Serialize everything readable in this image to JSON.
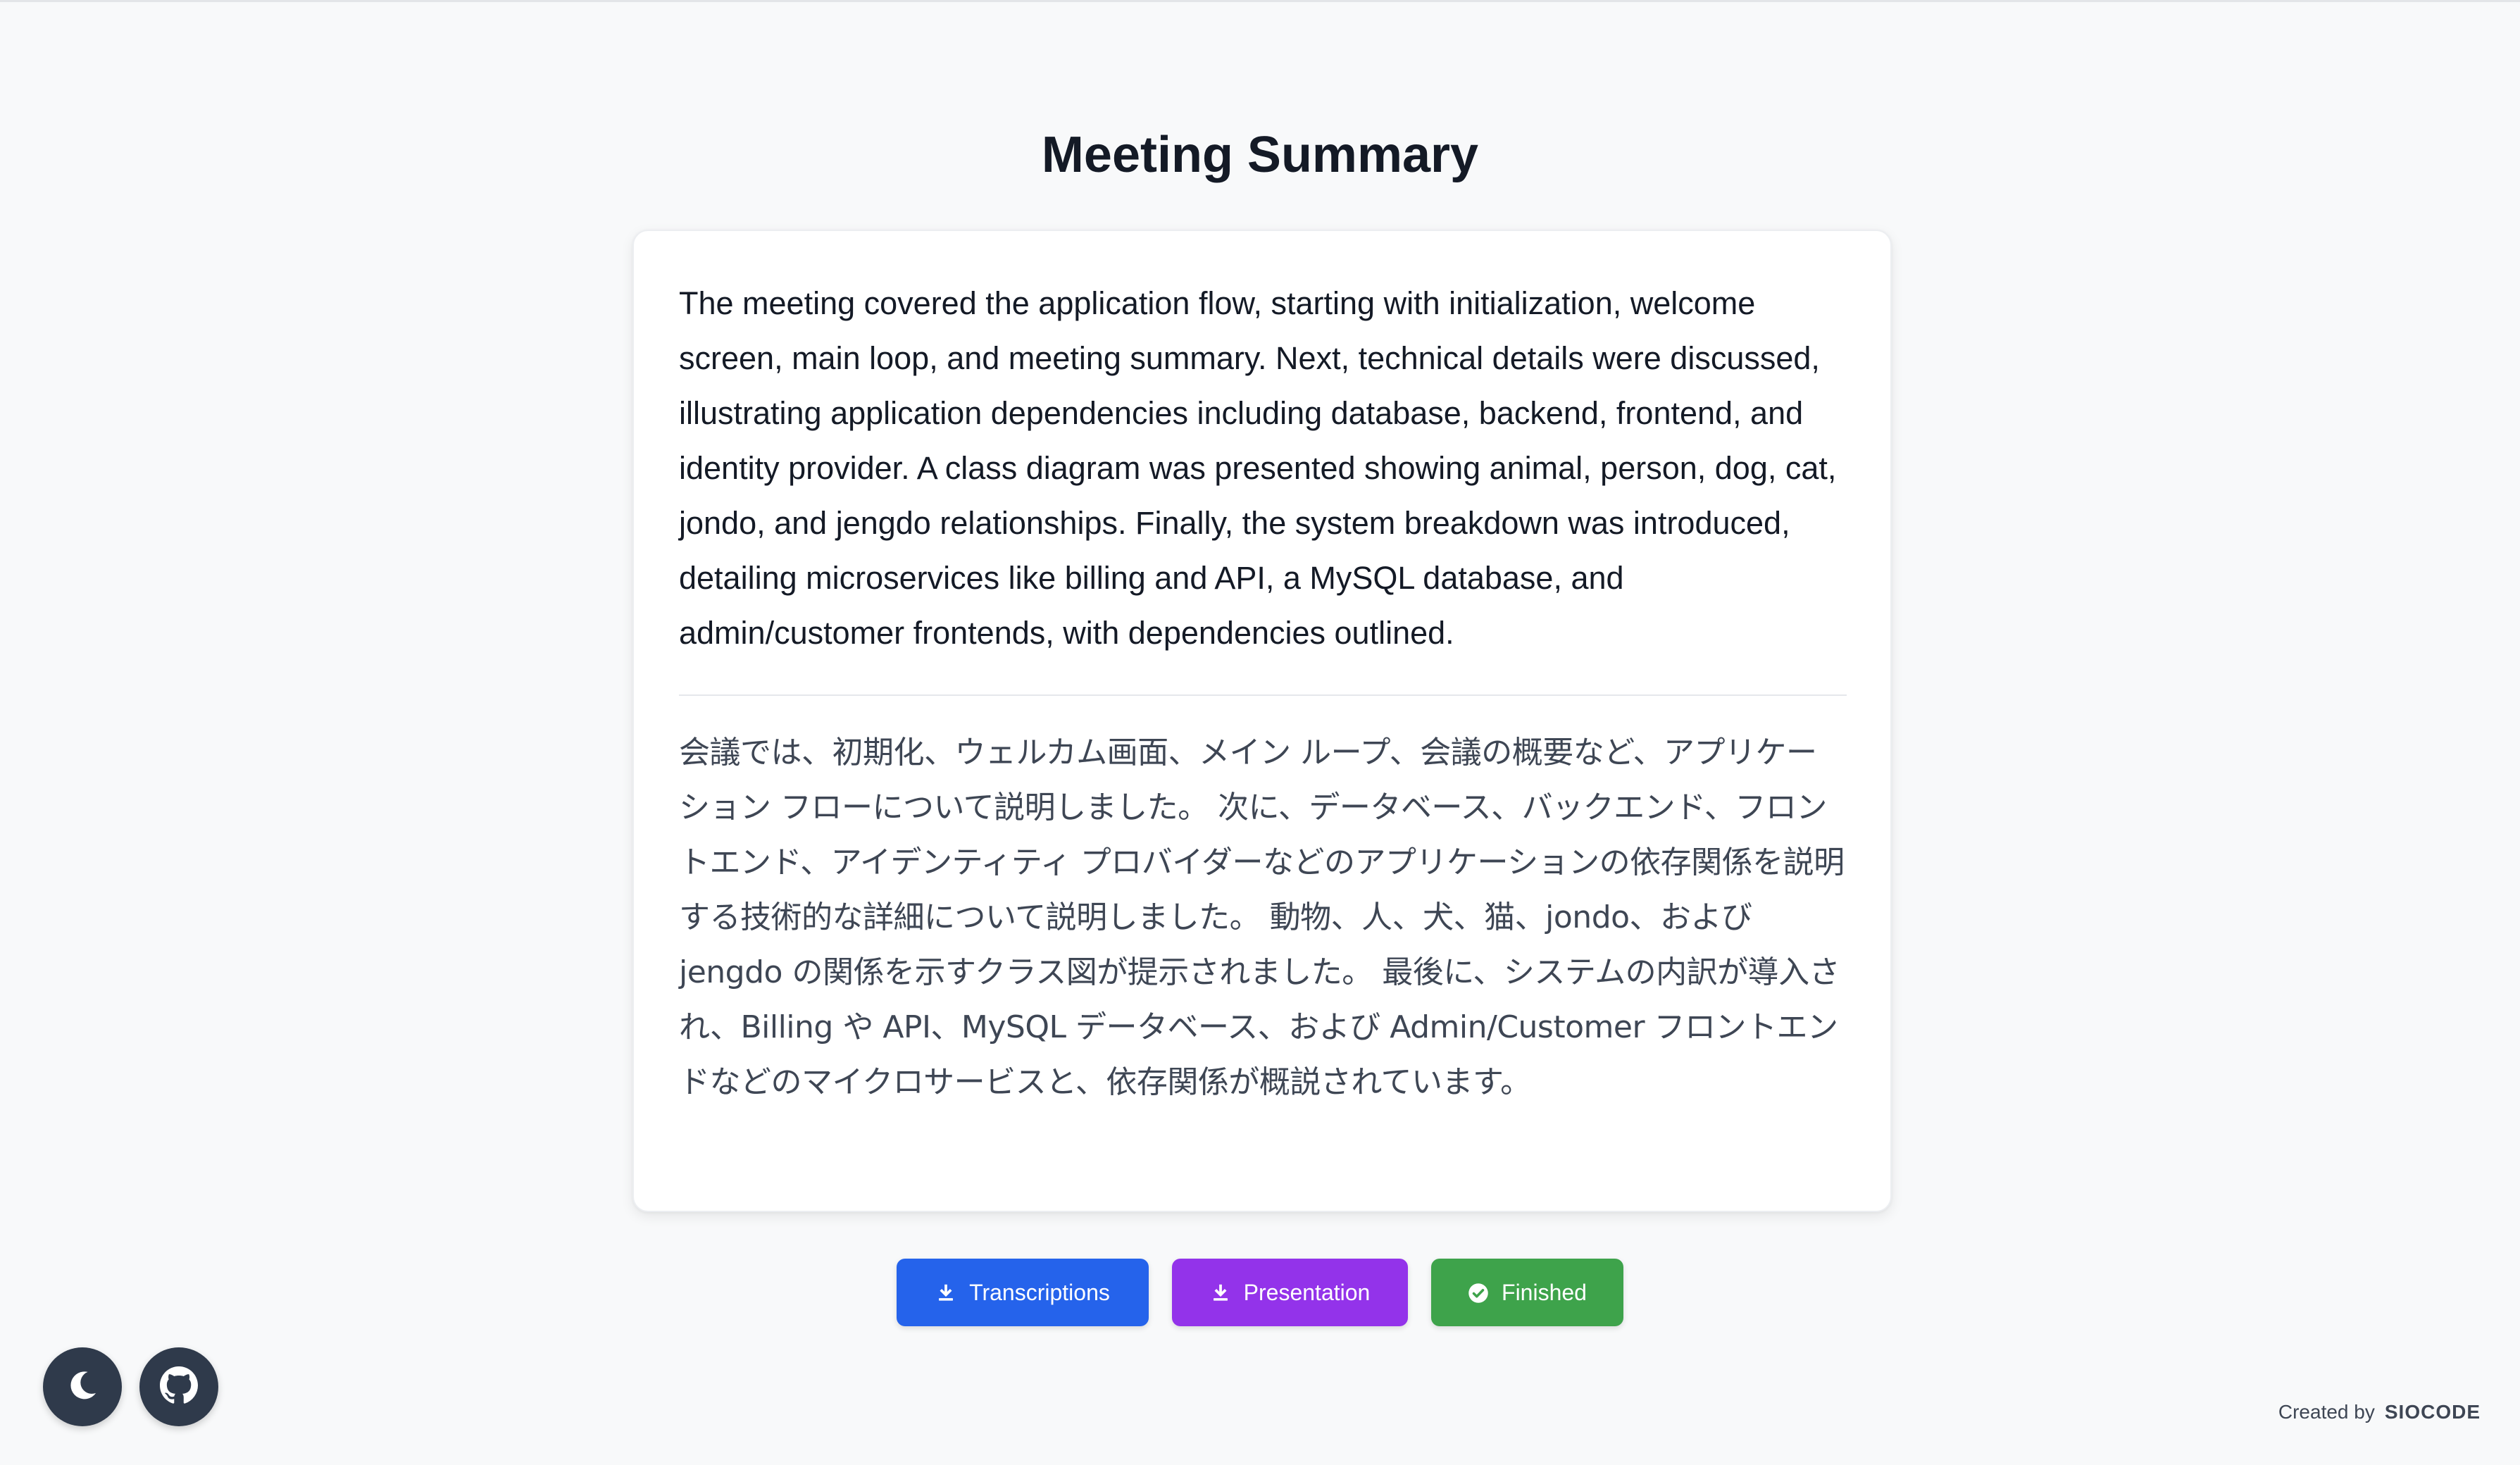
{
  "page": {
    "title": "Meeting Summary"
  },
  "summary": {
    "english": "The meeting covered the application flow, starting with initialization, welcome screen, main loop, and meeting summary.  Next, technical details were discussed, illustrating application dependencies including database, backend, frontend, and identity provider.  A class diagram was presented showing animal, person, dog, cat, jondo, and jengdo relationships. Finally, the system breakdown was introduced, detailing microservices like billing and API, a MySQL database, and admin/customer frontends, with dependencies outlined.",
    "japanese": "会議では、初期化、ウェルカム画面、メイン ループ、会議の概要など、アプリケーション フローについて説明しました。 次に、データベース、バックエンド、フロントエンド、アイデンティティ プロバイダーなどのアプリケーションの依存関係を説明する技術的な詳細について説明しました。 動物、人、犬、猫、jondo、および jengdo の関係を示すクラス図が提示されました。 最後に、システムの内訳が導入され、Billing や API、MySQL データベース、および Admin/Customer フロントエンドなどのマイクロサービスと、依存関係が概説されています。"
  },
  "actions": {
    "transcriptions": {
      "label": "Transcriptions",
      "icon": "download-icon",
      "color": "#2563eb"
    },
    "presentation": {
      "label": "Presentation",
      "icon": "download-icon",
      "color": "#9333ea"
    },
    "finished": {
      "label": "Finished",
      "icon": "check-circle-icon",
      "color": "#3ea34b"
    }
  },
  "floating": {
    "theme_toggle_icon": "moon-icon",
    "github_icon": "github-icon"
  },
  "footer": {
    "created_by": "Created by",
    "brand": "SIOCODE"
  }
}
